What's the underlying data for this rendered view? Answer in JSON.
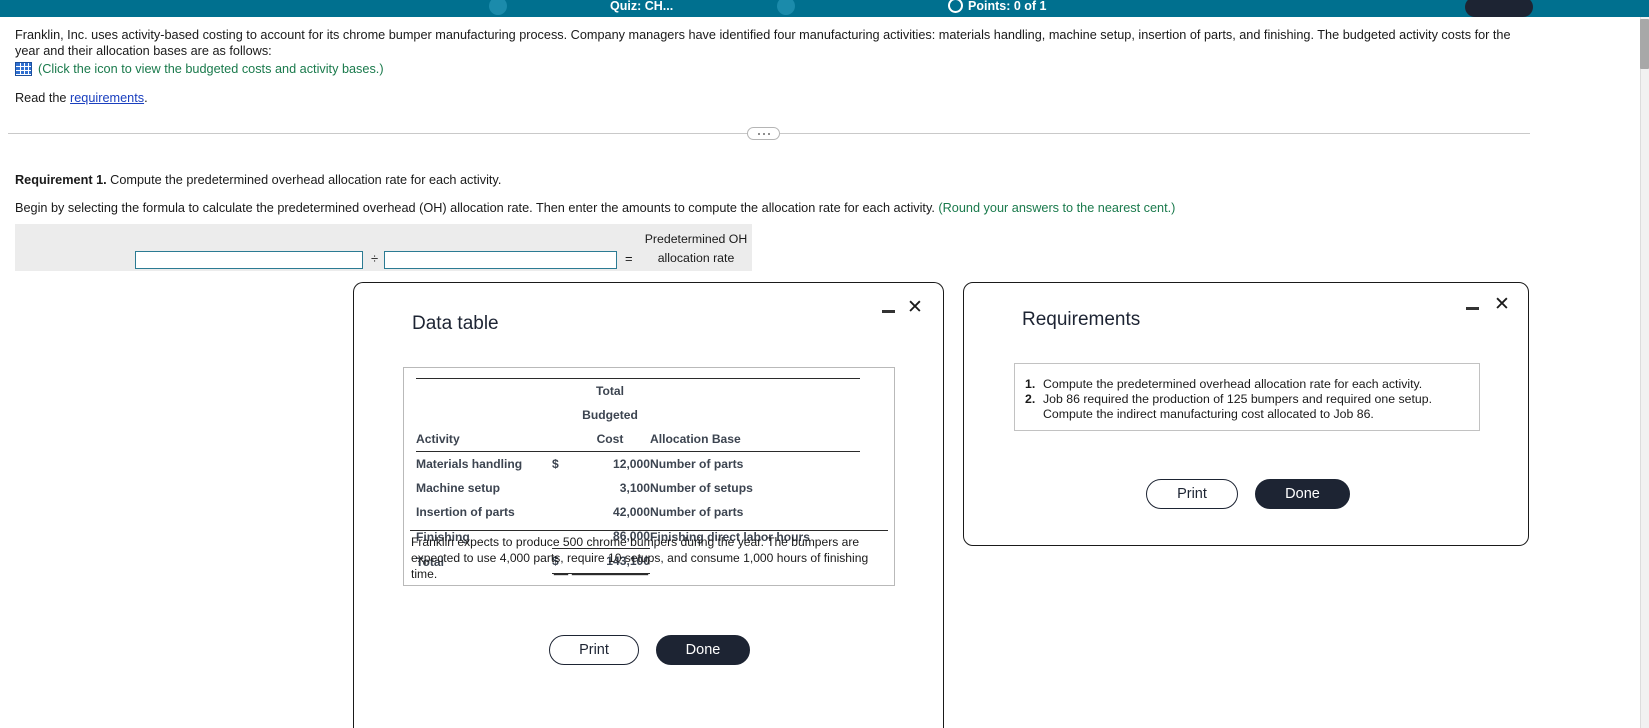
{
  "topbar": {
    "quiz_label": "Quiz: CH...",
    "points_label": "Points: 0 of 1",
    "accent_color": "#00708f"
  },
  "problem": {
    "statement": "Franklin, Inc. uses activity-based costing to account for its chrome bumper manufacturing process. Company managers have identified four manufacturing activities: materials handling, machine setup, insertion of parts, and finishing. The budgeted activity costs for the year and their allocation bases are as follows:",
    "icon_name": "grid-icon",
    "icon_link_text": "(Click the icon to view the budgeted costs and activity bases.)",
    "read_prefix": "Read the ",
    "read_link": "requirements",
    "read_suffix": "."
  },
  "requirement1": {
    "label": "Requirement 1.",
    "text": " Compute the predetermined overhead allocation rate for each activity.",
    "begin_text": "Begin by selecting the formula to calculate the predetermined overhead (OH) allocation rate. Then enter the amounts to compute the allocation rate for each activity. ",
    "round_note": "(Round your answers to the nearest cent.)",
    "formula": {
      "field1_value": "",
      "field1_placeholder": "",
      "divide_symbol": "÷",
      "field2_value": "",
      "field2_placeholder": "",
      "equals_symbol": "=",
      "result_label_line1": "Predetermined OH",
      "result_label_line2": "allocation rate"
    }
  },
  "data_table_dialog": {
    "title": "Data table",
    "minimize_icon": "minimize-icon",
    "close_icon": "close-icon",
    "table": {
      "header_group": "Total Budgeted",
      "columns": [
        "Activity",
        "Cost",
        "Allocation Base"
      ],
      "rows": [
        {
          "activity": "Materials handling",
          "currency": "$",
          "cost": "12,000",
          "base": "Number of parts"
        },
        {
          "activity": "Machine setup",
          "currency": "",
          "cost": "3,100",
          "base": "Number of setups"
        },
        {
          "activity": "Insertion of parts",
          "currency": "",
          "cost": "42,000",
          "base": "Number of parts"
        },
        {
          "activity": "Finishing",
          "currency": "",
          "cost": "86,000",
          "base": "Finishing direct labor hours"
        }
      ],
      "total_label": "Total",
      "total_currency": "$",
      "total_cost": "143,100"
    },
    "note": "Franklin expects to produce 500 chrome bumpers during the year. The bumpers are expected to use 4,000 parts, require 10 setups, and consume 1,000 hours of finishing time.",
    "print_label": "Print",
    "done_label": "Done"
  },
  "requirements_dialog": {
    "title": "Requirements",
    "minimize_icon": "minimize-icon",
    "close_icon": "close-icon",
    "items": [
      {
        "num": "1.",
        "text": "Compute the predetermined overhead allocation rate for each activity."
      },
      {
        "num": "2.",
        "text": "Job 86 required the production of 125 bumpers and required one setup. Compute the indirect manufacturing cost allocated to Job 86."
      }
    ],
    "print_label": "Print",
    "done_label": "Done"
  }
}
